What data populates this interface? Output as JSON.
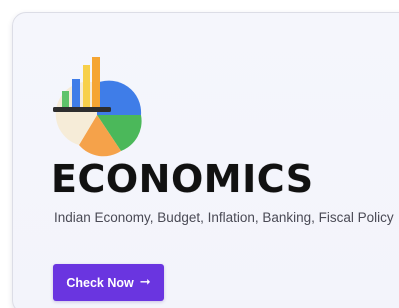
{
  "card": {
    "title": "ECONOMICS",
    "description": "Indian Economy, Budget, Inflation, Banking, Fiscal Policy",
    "button_label": "Check Now",
    "button_arrow": "➞",
    "icon": "chart-pie-bar-icon"
  },
  "colors": {
    "button_bg": "#6a35e0",
    "card_bg": "#f4f5fb",
    "pie_blue": "#3f7de8",
    "pie_green": "#4bb85a",
    "pie_orange": "#f5a24a",
    "pie_cream": "#f6ecd8",
    "bar_green": "#5fc36a",
    "bar_blue": "#3f7de8",
    "bar_orange": "#f5a533",
    "bar_yellow": "#f7d04a"
  }
}
